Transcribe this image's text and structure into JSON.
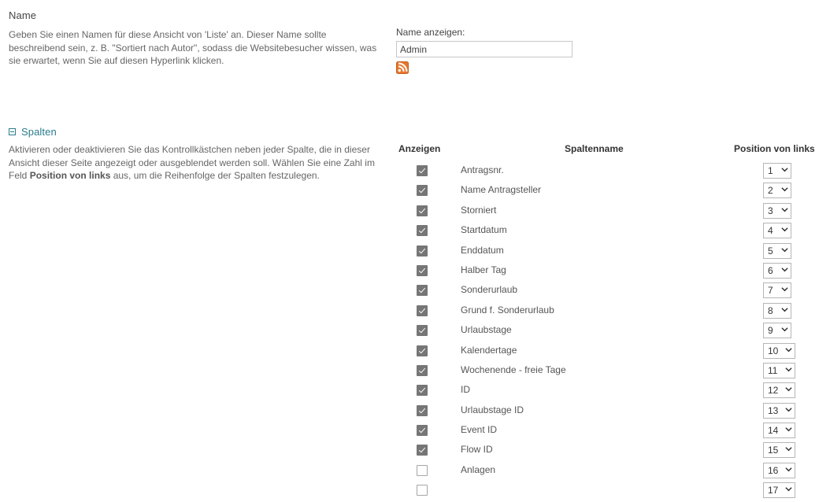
{
  "name_section": {
    "heading": "Name",
    "description": "Geben Sie einen Namen für diese Ansicht von 'Liste' an. Dieser Name sollte beschreibend sein, z. B. \"Sortiert nach Autor\", sodass die Websitebesucher wissen, was sie erwartet, wenn Sie auf diesen Hyperlink klicken.",
    "field_label": "Name anzeigen:",
    "field_value": "Admin",
    "field_placeholder": "",
    "rss_icon": "rss-icon"
  },
  "spalten_section": {
    "title": "Spalten",
    "collapse_icon": "collapse-minus-icon",
    "description_part1": "Aktivieren oder deaktivieren Sie das Kontrollkästchen neben jeder Spalte, die in dieser Ansicht dieser Seite angezeigt oder ausgeblendet werden soll. Wählen Sie eine Zahl im Feld ",
    "description_bold": "Position von links",
    "description_part2": " aus, um die Reihenfolge der Spalten festzulegen.",
    "headers": {
      "anzeigen": "Anzeigen",
      "spaltenname": "Spaltenname",
      "position": "Position von links"
    },
    "position_options": [
      "1",
      "2",
      "3",
      "4",
      "5",
      "6",
      "7",
      "8",
      "9",
      "10",
      "11",
      "12",
      "13",
      "14",
      "15",
      "16",
      "17"
    ],
    "rows": [
      {
        "checked": true,
        "label": "Antragsnr.",
        "position": "1"
      },
      {
        "checked": true,
        "label": "Name Antragsteller",
        "position": "2"
      },
      {
        "checked": true,
        "label": "Storniert",
        "position": "3"
      },
      {
        "checked": true,
        "label": "Startdatum",
        "position": "4"
      },
      {
        "checked": true,
        "label": "Enddatum",
        "position": "5"
      },
      {
        "checked": true,
        "label": "Halber Tag",
        "position": "6"
      },
      {
        "checked": true,
        "label": "Sonderurlaub",
        "position": "7"
      },
      {
        "checked": true,
        "label": "Grund f. Sonderurlaub",
        "position": "8"
      },
      {
        "checked": true,
        "label": "Urlaubstage",
        "position": "9"
      },
      {
        "checked": true,
        "label": "Kalendertage",
        "position": "10"
      },
      {
        "checked": true,
        "label": "Wochenende - freie Tage",
        "position": "11"
      },
      {
        "checked": true,
        "label": "ID",
        "position": "12"
      },
      {
        "checked": true,
        "label": "Urlaubstage ID",
        "position": "13"
      },
      {
        "checked": true,
        "label": "Event ID",
        "position": "14"
      },
      {
        "checked": true,
        "label": "Flow ID",
        "position": "15"
      },
      {
        "checked": false,
        "label": "Anlagen",
        "position": "16"
      },
      {
        "checked": false,
        "label": "",
        "position": "17"
      }
    ]
  },
  "colors": {
    "link": "#2b7b8c",
    "rss_orange": "#e8762c",
    "checkbox_fill": "#767676",
    "text": "#555555"
  }
}
